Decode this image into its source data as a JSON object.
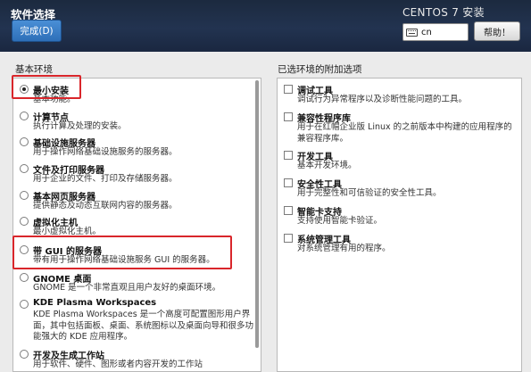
{
  "header": {
    "title": "软件选择",
    "done_label": "完成(D)",
    "product": "CENTOS 7 安装",
    "keyboard_layout": "cn",
    "help_label": "帮助！"
  },
  "base_env": {
    "label": "基本环境",
    "items": [
      {
        "title": "最小安装",
        "desc": "基本功能。",
        "selected": true
      },
      {
        "title": "计算节点",
        "desc": "执行计算及处理的安装。",
        "selected": false
      },
      {
        "title": "基础设施服务器",
        "desc": "用于操作网络基础设施服务的服务器。",
        "selected": false
      },
      {
        "title": "文件及打印服务器",
        "desc": "用于企业的文件、打印及存储服务器。",
        "selected": false
      },
      {
        "title": "基本网页服务器",
        "desc": "提供静态及动态互联网内容的服务器。",
        "selected": false
      },
      {
        "title": "虚拟化主机",
        "desc": "最小虚拟化主机。",
        "selected": false
      },
      {
        "title": "带 GUI 的服务器",
        "desc": "带有用于操作网络基础设施服务 GUI 的服务器。",
        "selected": false
      },
      {
        "title": "GNOME 桌面",
        "desc": "GNOME 是一个非常直观且用户友好的桌面环境。",
        "selected": false
      },
      {
        "title": "KDE Plasma Workspaces",
        "desc": "KDE Plasma Workspaces 是一个高度可配置图形用户界面，其中包括面板、桌面、系统图标以及桌面向导和很多功能强大的 KDE 应用程序。",
        "selected": false
      },
      {
        "title": "开发及生成工作站",
        "desc": "用于软件、硬件、图形或者内容开发的工作站",
        "selected": false
      }
    ]
  },
  "addons": {
    "label": "已选环境的附加选项",
    "items": [
      {
        "title": "调试工具",
        "desc": "调试行为异常程序以及诊断性能问题的工具。",
        "checked": false
      },
      {
        "title": "兼容性程序库",
        "desc": "用于在红帽企业版 Linux 的之前版本中构建的应用程序的兼容程序库。",
        "checked": false
      },
      {
        "title": "开发工具",
        "desc": "基本开发环境。",
        "checked": false
      },
      {
        "title": "安全性工具",
        "desc": "用于完整性和可信验证的安全性工具。",
        "checked": false
      },
      {
        "title": "智能卡支持",
        "desc": "支持使用智能卡验证。",
        "checked": false
      },
      {
        "title": "系统管理工具",
        "desc": "对系统管理有用的程序。",
        "checked": false
      }
    ]
  },
  "colors": {
    "header_bg": "#1f2f49",
    "done_button": "#3a7fc9",
    "highlight_box": "#d9262b"
  }
}
